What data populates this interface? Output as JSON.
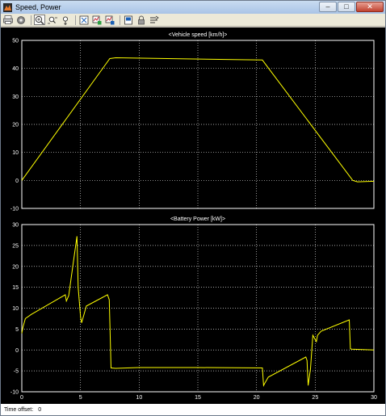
{
  "window": {
    "title": "Speed, Power",
    "controls": {
      "minimize": "–",
      "maximize": "□",
      "close": "✕"
    }
  },
  "toolbar": {
    "buttons": [
      {
        "icon": "print-icon"
      },
      {
        "icon": "parameters-icon"
      },
      {
        "icon": "zoom-in-icon",
        "pressed": true
      },
      {
        "icon": "zoom-x-icon"
      },
      {
        "icon": "zoom-y-icon"
      },
      {
        "icon": "autoscale-icon"
      },
      {
        "icon": "save-axes-icon"
      },
      {
        "icon": "restore-axes-icon"
      },
      {
        "icon": "floating-scope-icon"
      },
      {
        "icon": "lock-icon"
      },
      {
        "icon": "signal-selection-icon"
      }
    ]
  },
  "status": {
    "label": "Time offset:",
    "value": "0"
  },
  "colors": {
    "background": "#000000",
    "axes": "#ffffff",
    "grid": "#ffffff",
    "trace": "#ffff00"
  },
  "chart_data": [
    {
      "type": "line",
      "title": "<Vehicle speed [km/h]>",
      "xlim": [
        0,
        30
      ],
      "ylim": [
        -10,
        50
      ],
      "xticks": [],
      "yticks": [
        -10,
        0,
        10,
        20,
        30,
        40,
        50
      ],
      "grid": true,
      "series": [
        {
          "x": [
            0,
            7.5,
            8,
            20.5,
            28.2,
            28.6,
            30
          ],
          "y": [
            0,
            43.5,
            43.8,
            43.0,
            0,
            -0.5,
            -0.3
          ]
        }
      ]
    },
    {
      "type": "line",
      "title": "<Battery Power [kW]>",
      "xlim": [
        0,
        30
      ],
      "ylim": [
        -10,
        30
      ],
      "xticks": [
        0,
        5,
        10,
        15,
        20,
        25,
        30
      ],
      "yticks": [
        -10,
        -5,
        0,
        5,
        10,
        15,
        20,
        25,
        30
      ],
      "grid": true,
      "series": [
        {
          "x": [
            0,
            0.1,
            0.3,
            0.8,
            3.7,
            3.8,
            4.0,
            4.7,
            4.8,
            5.0,
            5.1,
            5.5,
            7.3,
            7.45,
            7.6,
            8.0,
            10,
            15,
            20.5,
            20.6,
            20.7,
            21,
            24.2,
            24.3,
            24.4,
            24.6,
            24.8,
            25.1,
            25.2,
            25.5,
            27.9,
            28.0,
            28.1,
            30
          ],
          "y": [
            4,
            5.5,
            7.5,
            8.5,
            13.2,
            11.7,
            13,
            27.2,
            15,
            8,
            6.5,
            10.5,
            13.2,
            12,
            -4.3,
            -4.4,
            -4.2,
            -4.2,
            -4.3,
            -8.5,
            -8,
            -6.5,
            -1.7,
            -2.5,
            -8.5,
            -4.5,
            3.5,
            2.0,
            3.5,
            4.5,
            7.2,
            0.3,
            0.2,
            0
          ]
        }
      ]
    }
  ]
}
